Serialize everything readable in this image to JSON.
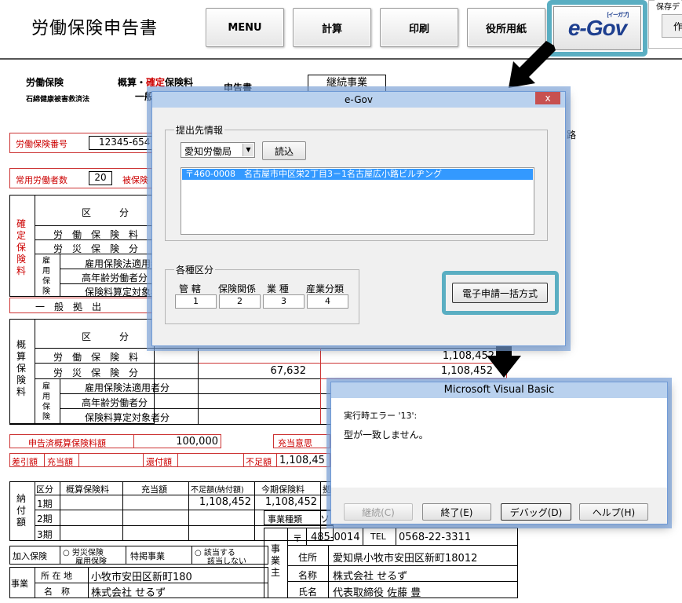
{
  "toolbar": {
    "title": "労働保険申告書",
    "menu": "MENU",
    "calc": "計算",
    "print": "印刷",
    "office_paper": "役所用紙",
    "egov_logo": "e-Gov",
    "egov_logo_sub": "[イーガブ]",
    "save_group": "保存デ",
    "save_btn": "作"
  },
  "form": {
    "header_left": "労働保険",
    "header_left_sub": "石綿健康被害救済法",
    "header_gaisan": "概算・",
    "header_kakutei": "確定",
    "header_hoken": "保険料",
    "header_shinkoku": "申告書",
    "header_ippan": "一般",
    "keizoku": "継続事業",
    "side_ro": "路",
    "hoken_bango_label": "労働保険番号",
    "hoken_bango": "12345-654",
    "joyo_label": "常用労働者数",
    "joyo_value": "20",
    "hihoken_label": "被保険",
    "kubun": "区　　　分",
    "kakutei_vertical": "確定保険料",
    "gaisan_vertical": "概算保険料",
    "koyo_vertical": "雇用保険",
    "row_rodo": "労　働　保　険　料",
    "row_rosai": "労　災　保　険　分",
    "row_koyo_tekiyo": "雇用保険法適用者分",
    "row_konenrei": "高年齢労働者分",
    "row_santei": "保険料算定対象者分",
    "ippan_kyoshutsu": "一　般　拠　出",
    "gaisan_rodo_value": "1,108,452",
    "gaisan_rosai_value1": "67,632",
    "gaisan_rosai_value2": "1,108,452",
    "shinkokuzumi_label": "申告済概算保険料額",
    "shinkokuzumi_value": "100,000",
    "juto_iko": "充当意思",
    "sahiki_label": "差引額",
    "juto_label": "充当額",
    "kanpu_label": "還付額",
    "fusoku_label": "不足額",
    "fusoku_value": "1,108,45",
    "nofu_vertical": "納付額",
    "nofu_headers": [
      "区分",
      "概算保険料",
      "充当額",
      "不足額(納付額)",
      "今期保険料",
      "拠"
    ],
    "nofu_rows": [
      {
        "kubun": "1期",
        "fusoku": "1,108,452",
        "konki": "1,108,452"
      },
      {
        "kubun": "2期",
        "fusoku": "",
        "konki": ""
      },
      {
        "kubun": "3期",
        "fusoku": "",
        "konki": ""
      }
    ],
    "jigyo_shurui": "事業種類",
    "jigyo_shurui_value": "ソ",
    "kanyu_label": "加入保険",
    "kanyu_opt1": "労災保険",
    "kanyu_opt2": "雇用保険",
    "tokuso_label": "特掲事業",
    "tokuso_opt1": "該当する",
    "tokuso_opt2": "該当しない",
    "jigyo_label": "事業",
    "shozaichi_label": "所 在 地",
    "shozaichi_value": "小牧市安田区新町180",
    "meisho_label": "名　称",
    "meisho_value": "株式会社 せるず",
    "jigyonushi_vertical": "事業主",
    "postal_mark": "〒",
    "postal_value": "485-0014",
    "tel_label": "TEL",
    "tel_value": "0568-22-3311",
    "jusho_label": "住所",
    "jusho_value": "愛知県小牧市安田区新町18012",
    "nushi_meisho_label": "名称",
    "nushi_meisho_value": "株式会社 せるず",
    "shimei_label": "氏名",
    "shimei_value": "代表取締役 佐藤 豊"
  },
  "egov_dialog": {
    "title": "e-Gov",
    "close": "x",
    "submit_group": "提出先情報",
    "office_select": "愛知労働局",
    "load_button": "読込",
    "address_item": "〒460-0008　名古屋市中区栄2丁目3－1名古屋広小路ビルヂング",
    "kubun_group": "各種区分",
    "kubun_labels": [
      "管 轄",
      "保険関係",
      "業 種",
      "産業分類"
    ],
    "kubun_values": [
      "1",
      "2",
      "3",
      "4"
    ],
    "apply_button": "電子申請一括方式"
  },
  "vb_dialog": {
    "title": "Microsoft Visual Basic",
    "error_line": "実行時エラー '13':",
    "error_msg": "型が一致しません。",
    "btn_continue": "継続(C)",
    "btn_end": "終了(E)",
    "btn_debug": "デバッグ(D)",
    "btn_help": "ヘルプ(H)"
  },
  "colors": {
    "highlight_frame": "#5aaec2",
    "form_red": "#cc3333",
    "selection": "#3399ff"
  }
}
